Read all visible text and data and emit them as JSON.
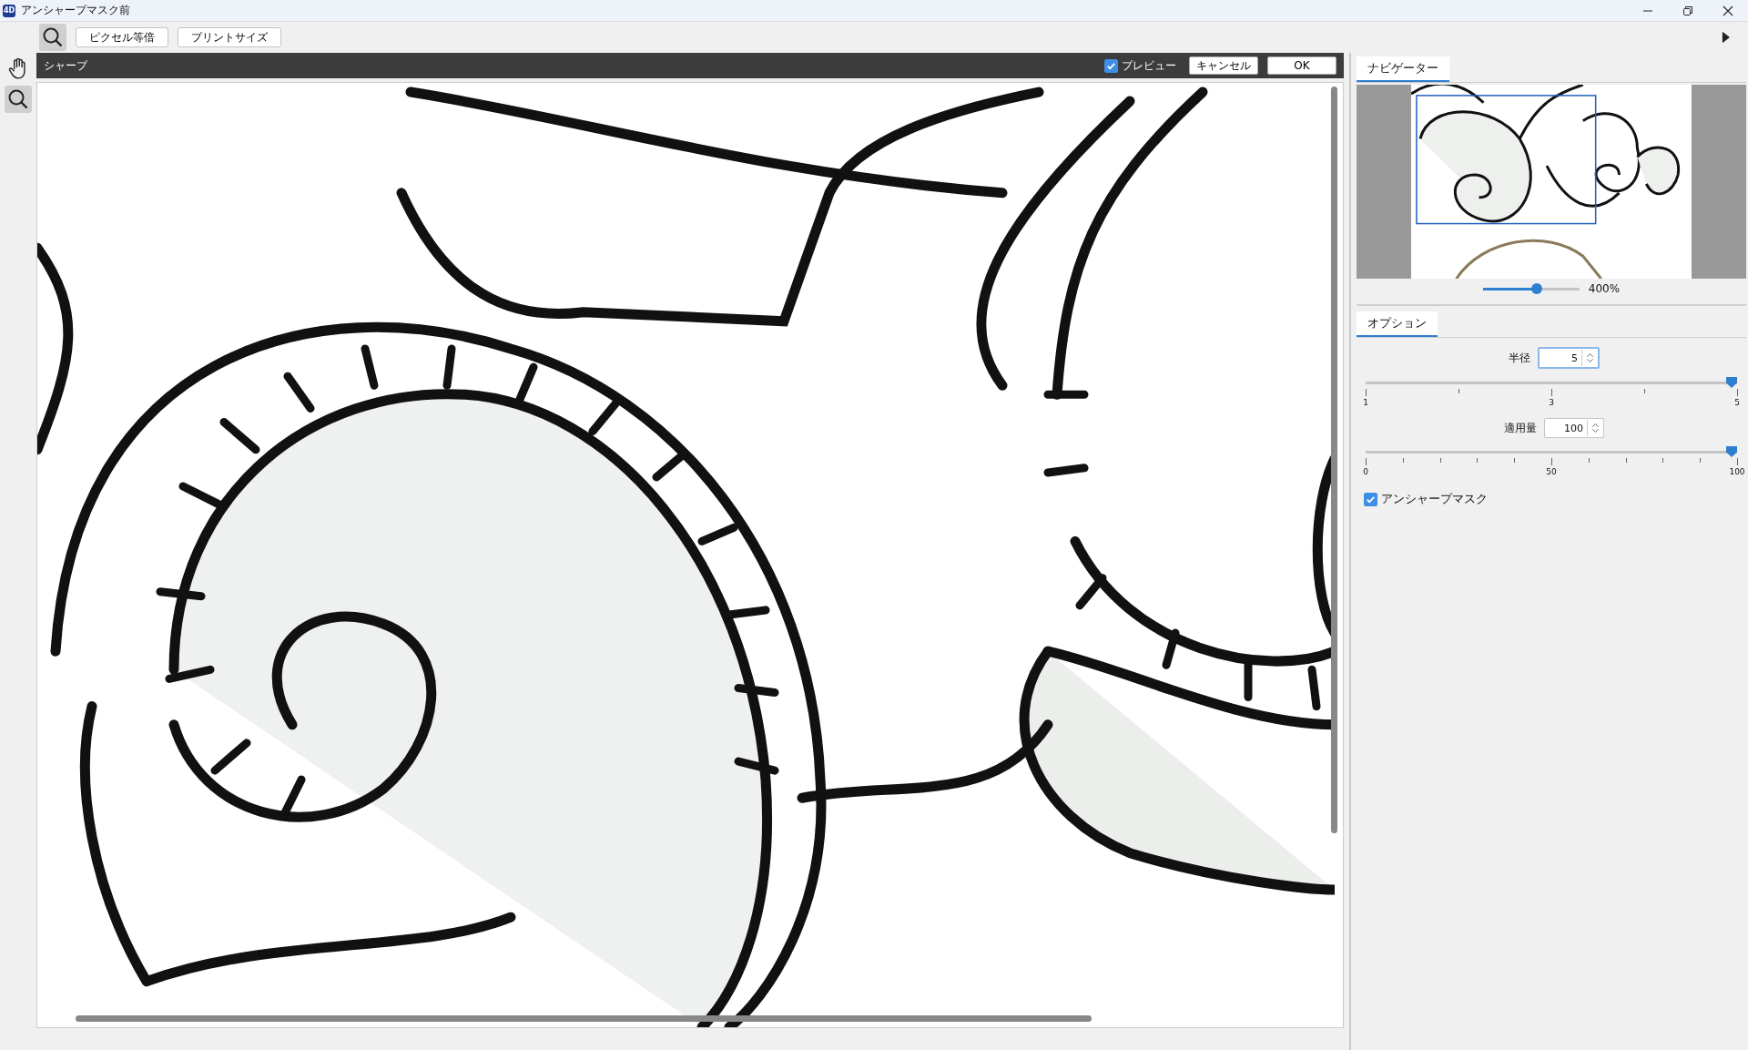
{
  "window": {
    "logo": "4D",
    "title": "アンシャープマスク前"
  },
  "toolbar": {
    "buttons": [
      "ピクセル等倍",
      "プリントサイズ"
    ]
  },
  "filter_panel": {
    "title": "シャープ",
    "preview": {
      "label": "プレビュー",
      "checked": true
    },
    "buttons": [
      "キャンセル",
      "OK"
    ]
  },
  "navigator": {
    "tab": {
      "label": "ナビゲーター",
      "selected": true
    },
    "zoom": {
      "level": 0.56,
      "reading": "400%"
    }
  },
  "options": {
    "tab": {
      "label": "オプション",
      "selected": true
    },
    "fields": [
      {
        "label": "半径",
        "value": "5",
        "focused": true,
        "slider": {
          "level": 1,
          "ticks": [
            "1",
            "3",
            "5"
          ]
        }
      },
      {
        "label": "適用量",
        "value": "100",
        "focused": false,
        "slider": {
          "level": 1,
          "ticks": [
            "0",
            "50",
            "100"
          ]
        }
      }
    ],
    "unsharp_mask": {
      "label": "アンシャープマスク",
      "checked": true
    }
  }
}
